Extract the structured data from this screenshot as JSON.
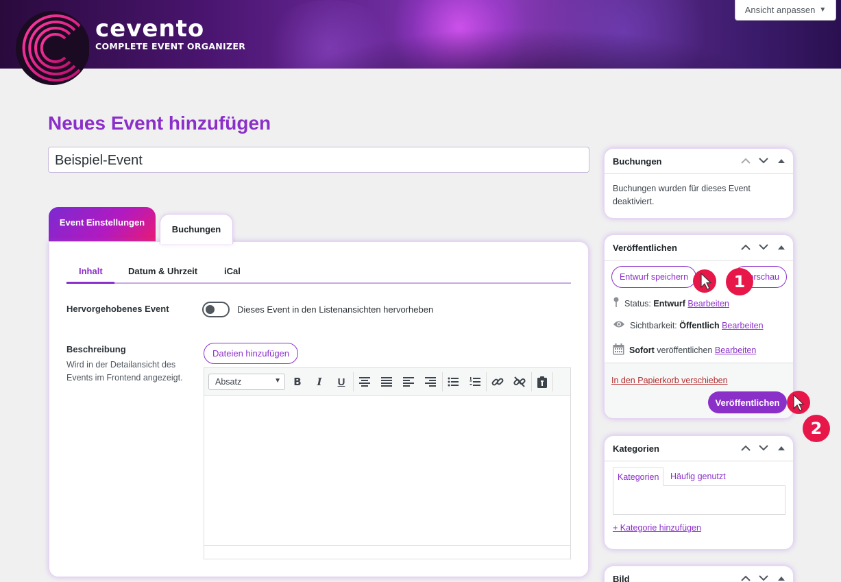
{
  "brand": {
    "name": "cevento",
    "tagline": "COMPLETE EVENT ORGANIZER",
    "accent": "#8b2fc9"
  },
  "header": {
    "view_button_label": "Ansicht anpassen"
  },
  "page": {
    "title": "Neues Event hinzufügen",
    "event_title_value": "Beispiel-Event"
  },
  "main_tabs": [
    {
      "label": "Event Einstellungen",
      "active": true
    },
    {
      "label": "Buchungen",
      "active": false
    }
  ],
  "sub_tabs": [
    {
      "label": "Inhalt",
      "active": true
    },
    {
      "label": "Datum & Uhrzeit",
      "active": false
    },
    {
      "label": "iCal",
      "active": false
    }
  ],
  "fields": {
    "featured_label": "Hervorgehobenes Event",
    "featured_toggle_text": "Dieses Event in den Listenansichten hervorheben",
    "featured_on": false,
    "description_label": "Beschreibung",
    "description_help": "Wird in der Detailansicht des Events im Frontend angezeigt.",
    "add_files_button": "Dateien hinzufügen"
  },
  "editor": {
    "format_select": "Absatz",
    "toolbar_icons": [
      "bold-icon",
      "italic-icon",
      "underline-icon",
      "align-center-icon",
      "align-justify-icon",
      "align-left-icon",
      "align-right-icon",
      "bullet-list-icon",
      "numbered-list-icon",
      "link-icon",
      "unlink-icon",
      "paste-icon"
    ]
  },
  "sidebar": {
    "bookings_box": {
      "title": "Buchungen",
      "text": "Buchungen wurden für dieses Event deaktiviert."
    },
    "publish_box": {
      "title": "Veröffentlichen",
      "save_draft_button": "Entwurf speichern",
      "preview_button": "Vorschau",
      "status_label": "Status:",
      "status_value": "Entwurf",
      "visibility_label": "Sichtbarkeit:",
      "visibility_value": "Öffentlich",
      "schedule_value": "Sofort",
      "schedule_label": "veröffentlichen",
      "edit_link": "Bearbeiten",
      "trash_link": "In den Papierkorb verschieben",
      "publish_button": "Veröffentlichen"
    },
    "categories_box": {
      "title": "Kategorien",
      "tab_all": "Kategorien",
      "tab_popular": "Häufig genutzt",
      "add_link": "+ Kategorie hinzufügen"
    },
    "image_box": {
      "title": "Bild"
    }
  },
  "annotations": {
    "step1": "1",
    "step2": "2",
    "color": "#e8174a"
  }
}
